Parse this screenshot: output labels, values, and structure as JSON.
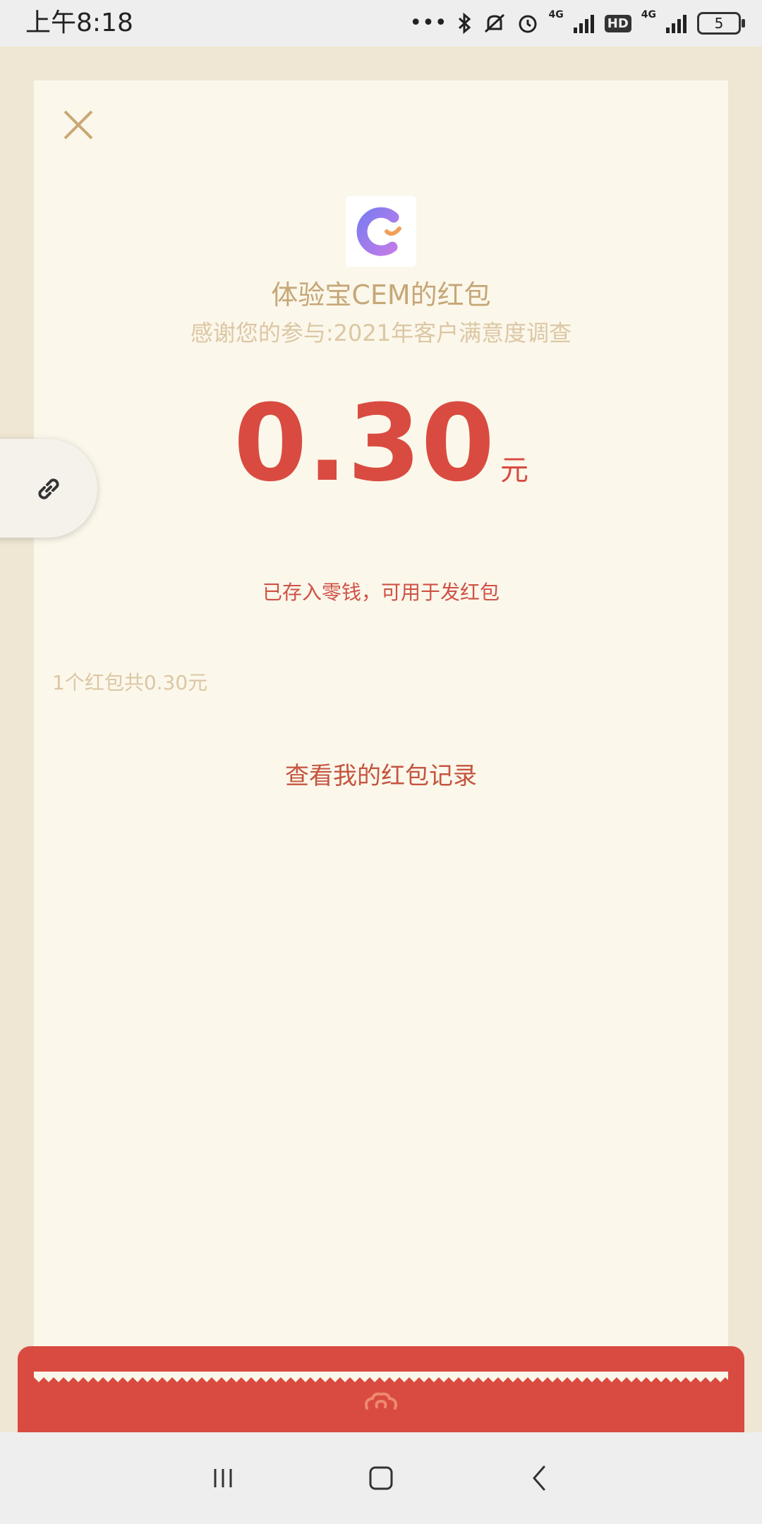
{
  "status_bar": {
    "time": "上午8:18",
    "dots": "•••",
    "network_1": "4G",
    "network_2": "4G",
    "hd": "HD",
    "battery": "5"
  },
  "envelope": {
    "sender_title": "体验宝CEM的红包",
    "subtitle": "感谢您的参与:2021年客户满意度调查",
    "amount": "0.30",
    "unit": "元",
    "stored_note": "已存入零钱，可用于发红包",
    "summary": "1个红包共0.30元",
    "records_link": "查看我的红包记录"
  },
  "icons": {
    "close": "close-icon",
    "avatar": "cem-logo-icon",
    "link": "link-icon",
    "cloud": "auspicious-cloud-icon",
    "nav_recent": "recent-apps-icon",
    "nav_home": "home-icon",
    "nav_back": "back-icon"
  },
  "colors": {
    "background": "#efe6d3",
    "sheet": "#fbf7eb",
    "gold_text": "#c6a777",
    "amount_red": "#d94b40",
    "band_red": "#d94b40"
  }
}
